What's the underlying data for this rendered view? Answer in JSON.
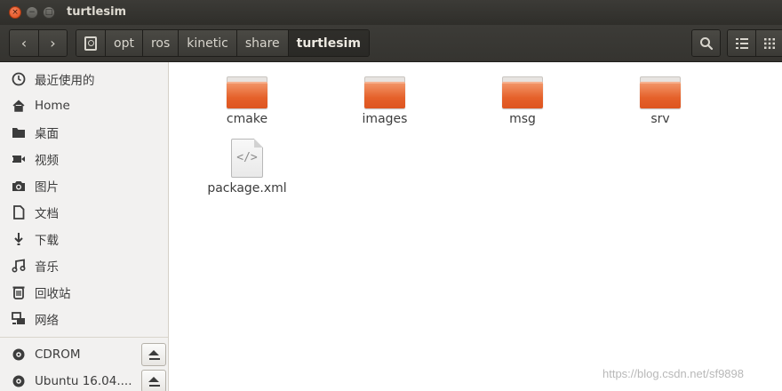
{
  "window": {
    "title": "turtlesim",
    "controls": {
      "close": "×",
      "minimize": "−",
      "maximize": "□"
    }
  },
  "toolbar": {
    "back_icon": "‹",
    "forward_icon": "›",
    "breadcrumbs": [
      "opt",
      "ros",
      "kinetic",
      "share",
      "turtlesim"
    ],
    "active_breadcrumb": "turtlesim",
    "search_icon": "search-icon",
    "list_view_icon": "list-view-icon",
    "grid_view_icon": "grid-view-icon"
  },
  "sidebar": {
    "items": [
      {
        "label": "最近使用的",
        "icon": "clock-icon"
      },
      {
        "label": "Home",
        "icon": "home-icon"
      },
      {
        "label": "桌面",
        "icon": "desktop-folder-icon"
      },
      {
        "label": "视频",
        "icon": "video-icon"
      },
      {
        "label": "图片",
        "icon": "camera-icon"
      },
      {
        "label": "文档",
        "icon": "document-icon"
      },
      {
        "label": "下载",
        "icon": "download-icon"
      },
      {
        "label": "音乐",
        "icon": "music-icon"
      },
      {
        "label": "回收站",
        "icon": "trash-icon"
      },
      {
        "label": "网络",
        "icon": "network-icon"
      }
    ],
    "devices": [
      {
        "label": "CDROM",
        "icon": "disc-icon",
        "eject": true
      },
      {
        "label": "Ubuntu 16.04....",
        "icon": "disc-icon",
        "eject": true
      }
    ]
  },
  "content": {
    "files": [
      {
        "name": "cmake",
        "type": "folder"
      },
      {
        "name": "images",
        "type": "folder"
      },
      {
        "name": "msg",
        "type": "folder"
      },
      {
        "name": "srv",
        "type": "folder"
      },
      {
        "name": "package.xml",
        "type": "xml-file",
        "glyph": "</>"
      }
    ]
  },
  "watermark": "https://blog.csdn.net/sf9898"
}
